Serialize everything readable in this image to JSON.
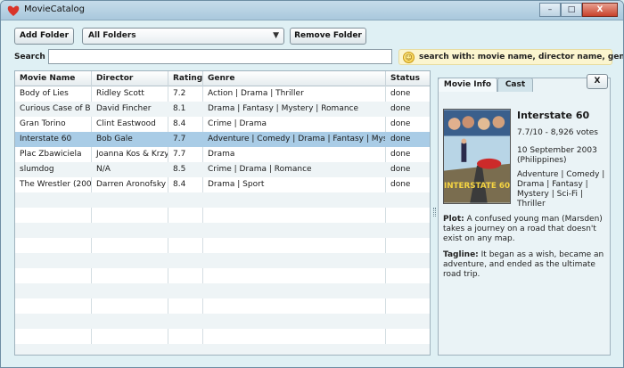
{
  "window": {
    "title": "MovieCatalog",
    "minimize": "–",
    "maximize": "□",
    "close": "X"
  },
  "toolbar": {
    "add_folder": "Add Folder",
    "folder_selected": "All Folders",
    "remove_folder": "Remove Folder",
    "search_label": "Search",
    "search_value": "",
    "hint": "search with: movie name, director name, genre"
  },
  "table": {
    "headers": [
      "Movie Name",
      "Director",
      "Rating",
      "Genre",
      "Status"
    ],
    "rows": [
      [
        "Body of Lies",
        "Ridley Scott",
        "7.2",
        "Action | Drama | Thriller",
        "done"
      ],
      [
        "Curious Case of B",
        "David Fincher",
        "8.1",
        "Drama | Fantasy | Mystery | Romance",
        "done"
      ],
      [
        "Gran Torino",
        "Clint Eastwood",
        "8.4",
        "Crime | Drama",
        "done"
      ],
      [
        "Interstate 60",
        "Bob Gale",
        "7.7",
        "Adventure | Comedy | Drama | Fantasy | Mys",
        "done"
      ],
      [
        "Plac Zbawiciela",
        "Joanna Kos & Krzy",
        "7.7",
        "Drama",
        "done"
      ],
      [
        "slumdog",
        "N/A",
        "8.5",
        "Crime | Drama | Romance",
        "done"
      ],
      [
        "The Wrestler (200",
        "Darren Aronofsky",
        "8.4",
        "Drama | Sport",
        "done"
      ]
    ],
    "selected_index": 3
  },
  "panel": {
    "tab_info": "Movie Info",
    "tab_cast": "Cast",
    "close": "X",
    "title": "Interstate 60",
    "rating_votes": "7.7/10 - 8,926 votes",
    "release": "10 September 2003 (Philippines)",
    "genres": "Adventure | Comedy | Drama | Fantasy | Mystery | Sci-Fi | Thriller",
    "plot_label": "Plot:",
    "plot": "A confused young man (Marsden) takes a journey on a road that doesn't exist on any map.",
    "tagline_label": "Tagline:",
    "tagline": "It began as a wish, became an adventure, and ended as the ultimate road trip.",
    "poster_text": "INTERSTATE 60"
  },
  "colors": {
    "selected_row": "#a9cce6",
    "window_bg": "#dff0f4",
    "hint_bg": "#fbf5cf"
  }
}
